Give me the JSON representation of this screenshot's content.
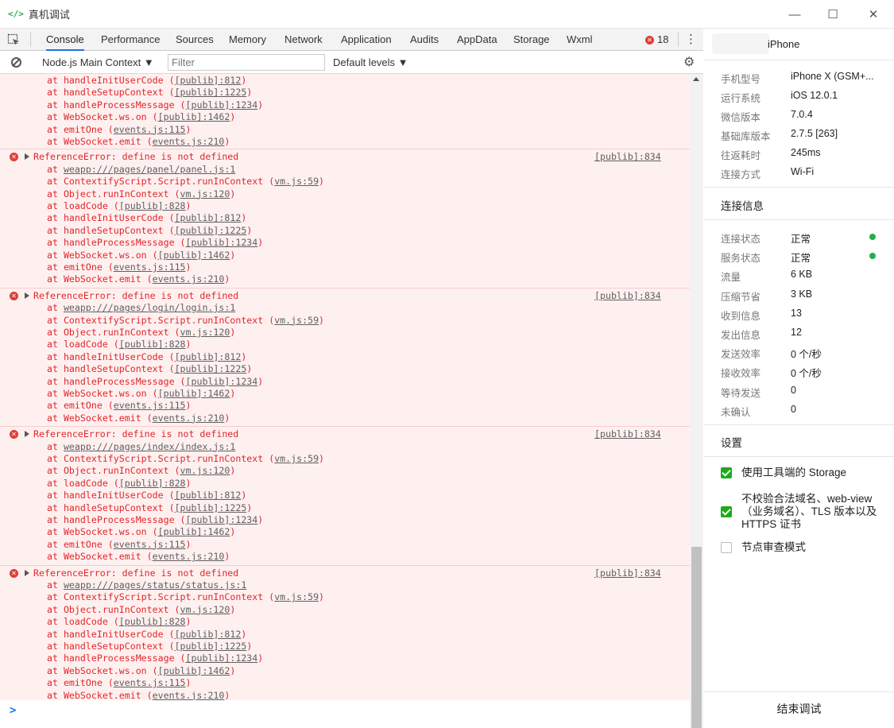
{
  "window": {
    "app_icon": "</>",
    "title": "真机调试",
    "controls": [
      "—",
      "☐",
      "✕"
    ]
  },
  "tabs": [
    "Console",
    "Performance",
    "Sources",
    "Memory",
    "Network",
    "Application",
    "Audits",
    "AppData",
    "Storage",
    "Wxml"
  ],
  "active_tab": "Console",
  "error_count": "18",
  "filterbar": {
    "context": "Node.js Main Context ▼",
    "filter_placeholder": "Filter",
    "levels": "Default levels ▼"
  },
  "console": {
    "partial_top": [
      {
        "fn": "handleInitUserCode",
        "src": "[publib]:812"
      },
      {
        "fn": "handleSetupContext",
        "src": "[publib]:1225"
      },
      {
        "fn": "handleProcessMessage",
        "src": "[publib]:1234"
      },
      {
        "fn": "WebSocket.ws.on",
        "src": "[publib]:1462"
      },
      {
        "fn": "emitOne",
        "src": "events.js:115"
      },
      {
        "fn": "WebSocket.emit",
        "src": "events.js:210"
      }
    ],
    "errors": [
      {
        "message": "ReferenceError: define is not defined",
        "source": "[publib]:834",
        "first_frame": "weapp:///pages/panel/panel.js:1"
      },
      {
        "message": "ReferenceError: define is not defined",
        "source": "[publib]:834",
        "first_frame": "weapp:///pages/login/login.js:1"
      },
      {
        "message": "ReferenceError: define is not defined",
        "source": "[publib]:834",
        "first_frame": "weapp:///pages/index/index.js:1"
      },
      {
        "message": "ReferenceError: define is not defined",
        "source": "[publib]:834",
        "first_frame": "weapp:///pages/status/status.js:1"
      }
    ],
    "common_frames": [
      {
        "fn": "ContextifyScript.Script.runInContext",
        "src": "vm.js:59"
      },
      {
        "fn": "Object.runInContext",
        "src": "vm.js:120"
      },
      {
        "fn": "loadCode",
        "src": "[publib]:828"
      },
      {
        "fn": "handleInitUserCode",
        "src": "[publib]:812"
      },
      {
        "fn": "handleSetupContext",
        "src": "[publib]:1225"
      },
      {
        "fn": "handleProcessMessage",
        "src": "[publib]:1234"
      },
      {
        "fn": "WebSocket.ws.on",
        "src": "[publib]:1462"
      },
      {
        "fn": "emitOne",
        "src": "events.js:115"
      },
      {
        "fn": "WebSocket.emit",
        "src": "events.js:210"
      }
    ],
    "prompt_symbol": ">"
  },
  "device": {
    "name": "iPhone",
    "info": [
      {
        "label": "手机型号",
        "value": "iPhone X (GSM+..."
      },
      {
        "label": "运行系统",
        "value": "iOS 12.0.1"
      },
      {
        "label": "微信版本",
        "value": "7.0.4"
      },
      {
        "label": "基础库版本",
        "value": "2.7.5 [263]"
      },
      {
        "label": "往返耗时",
        "value": "245ms"
      },
      {
        "label": "连接方式",
        "value": "Wi-Fi"
      }
    ]
  },
  "connection": {
    "title": "连接信息",
    "rows": [
      {
        "label": "连接状态",
        "value": "正常",
        "status": "ok"
      },
      {
        "label": "服务状态",
        "value": "正常",
        "status": "ok"
      },
      {
        "label": "流量",
        "value": "6 KB"
      },
      {
        "label": "压缩节省",
        "value": "3 KB"
      },
      {
        "label": "收到信息",
        "value": "13"
      },
      {
        "label": "发出信息",
        "value": "12"
      },
      {
        "label": "发送效率",
        "value": "0 个/秒"
      },
      {
        "label": "接收效率",
        "value": "0 个/秒"
      },
      {
        "label": "等待发送",
        "value": "0"
      },
      {
        "label": "未确认",
        "value": "0"
      }
    ],
    "ok_color": "#21b04b"
  },
  "settings": {
    "title": "设置",
    "options": [
      {
        "label": "使用工具端的 Storage",
        "checked": true
      },
      {
        "label": "不校验合法域名、web-view（业务域名）、TLS 版本以及 HTTPS 证书",
        "checked": true
      },
      {
        "label": "节点审查模式",
        "checked": false
      }
    ]
  },
  "end_button": "结束调试",
  "colors": {
    "error_text": "#e0262a",
    "error_bg": "#fff0f0",
    "accent": "#1a73e8",
    "checkbox": "#1aad19"
  }
}
